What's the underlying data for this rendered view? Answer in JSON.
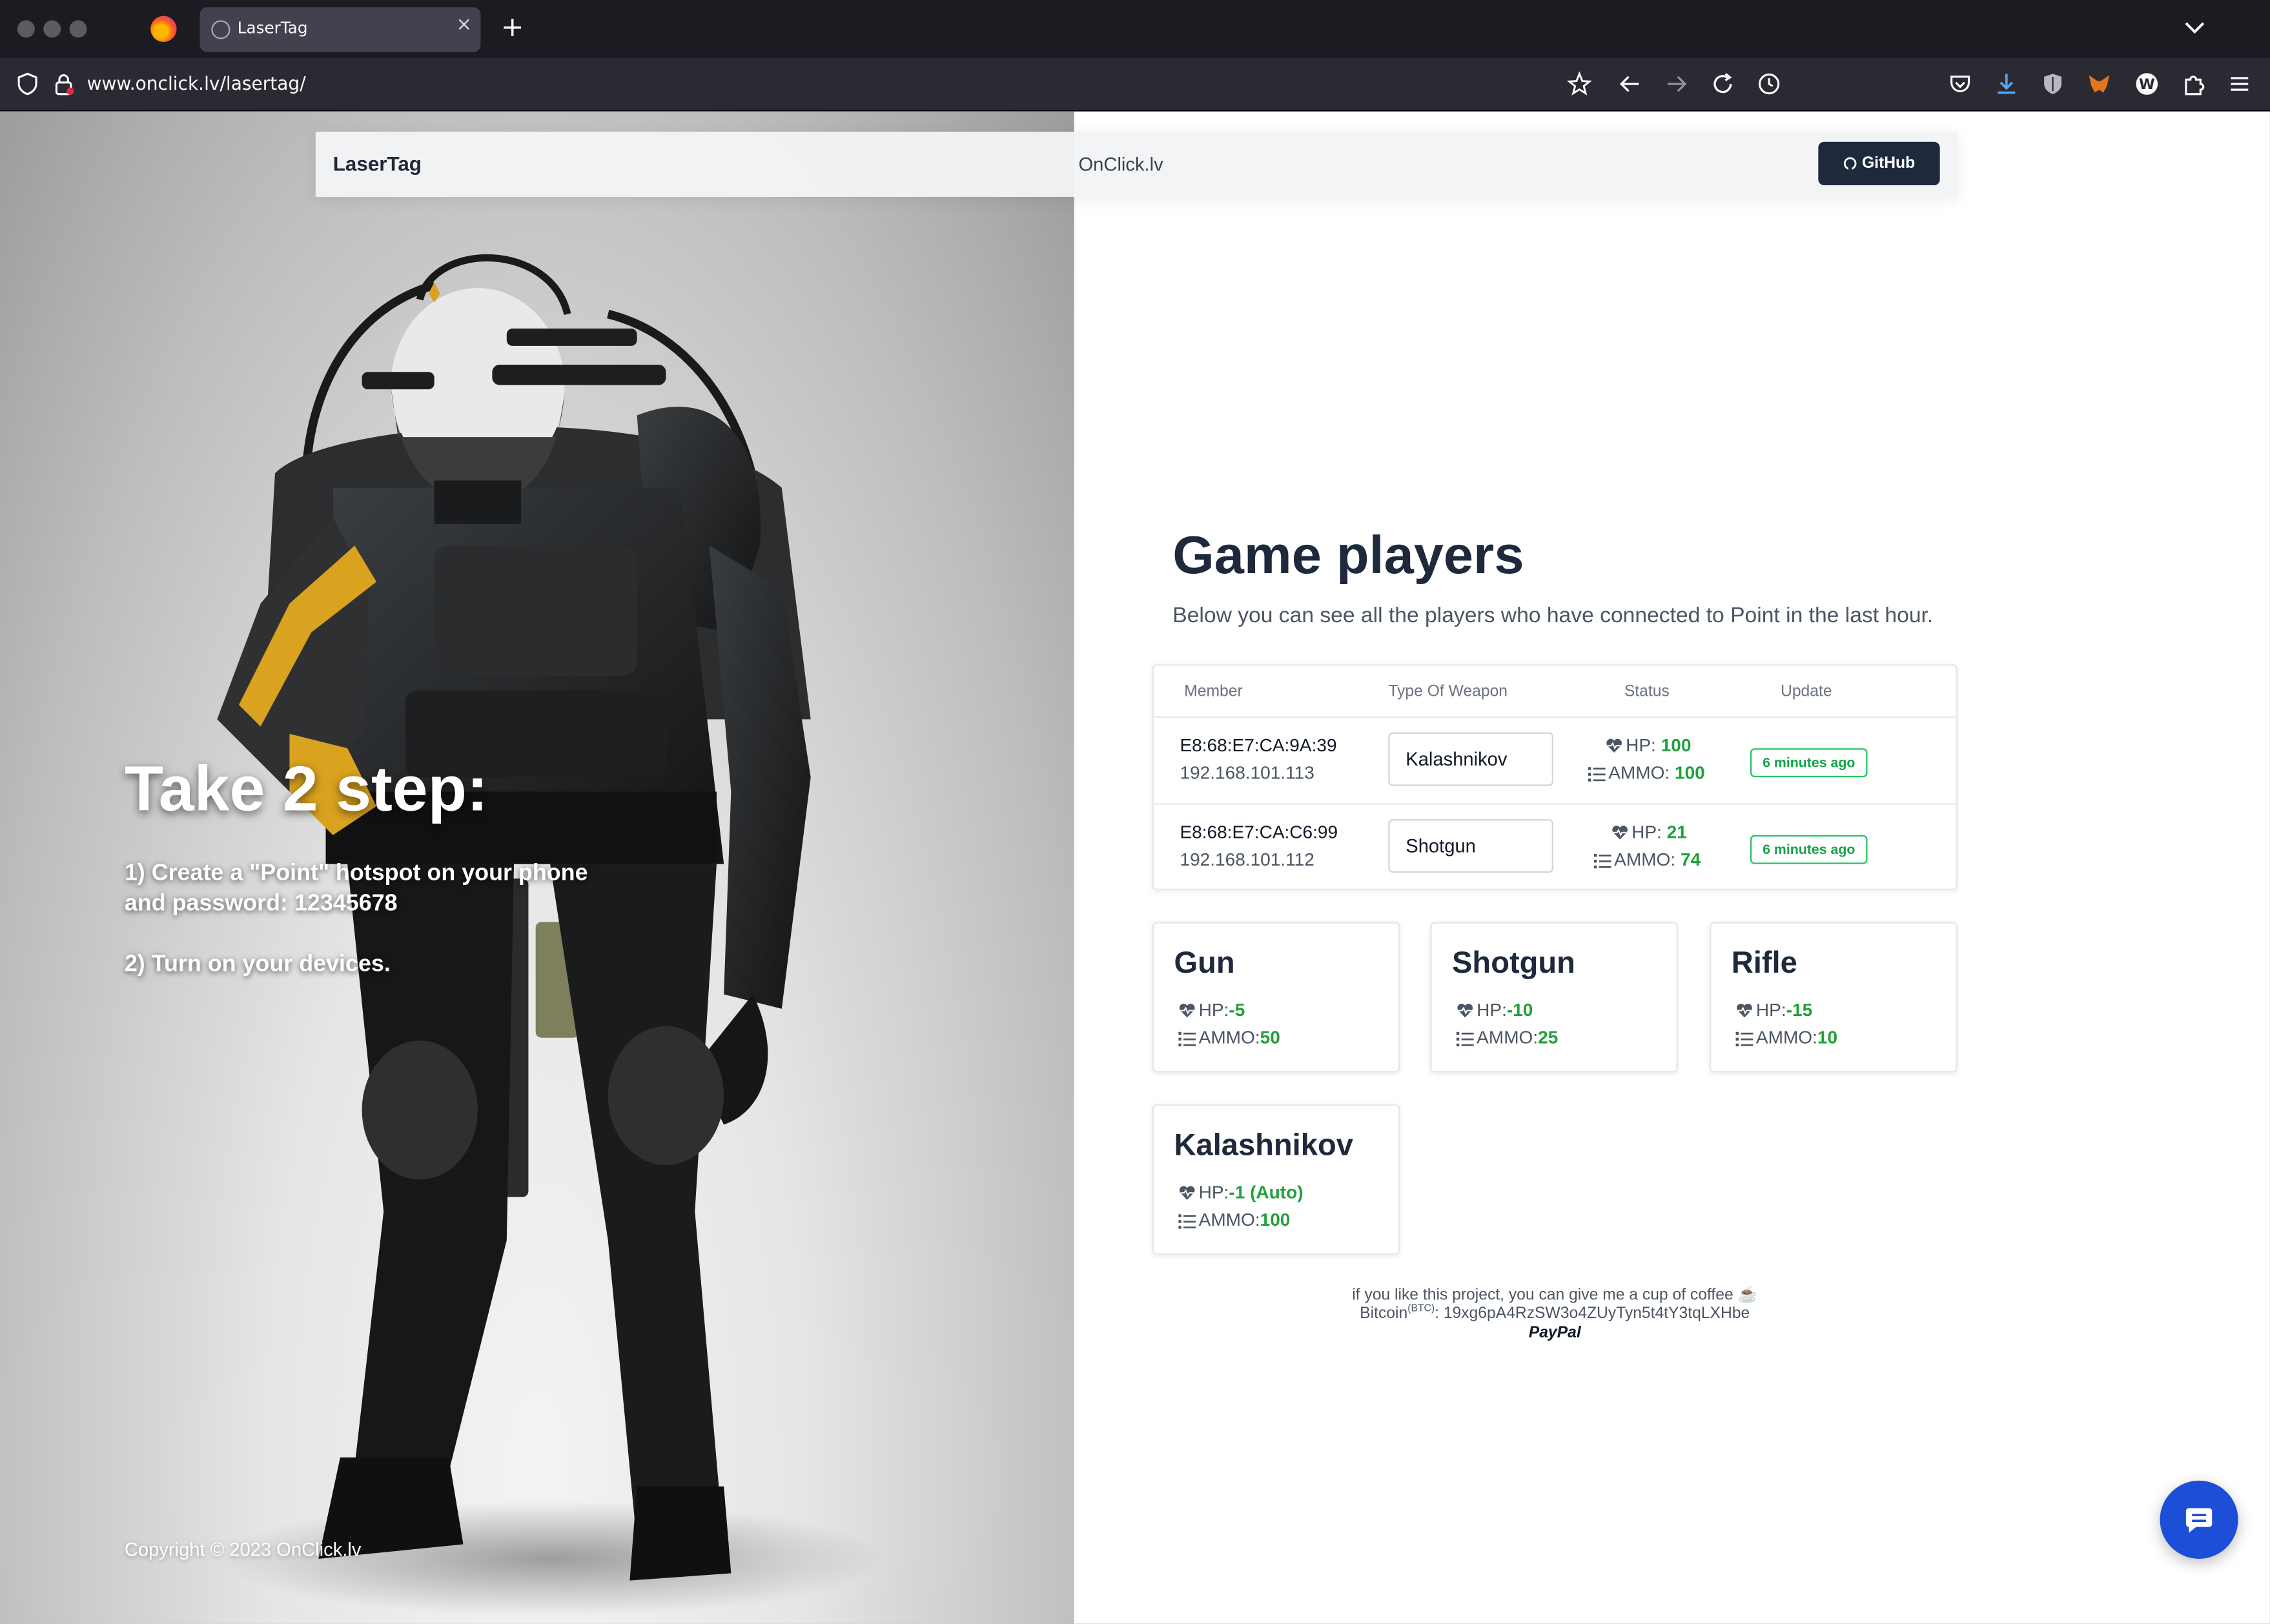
{
  "browser": {
    "tab_title": "LaserTag",
    "tab_close": "×",
    "new_tab": "+",
    "url": "www.onclick.lv/lasertag/"
  },
  "nav": {
    "brand": "LaserTag",
    "link": "OnClick.lv",
    "github_label": "GitHub"
  },
  "hero": {
    "title": "Take 2 step:",
    "step1_line1": "1) Create a \"Point\" hotspot on your phone",
    "step1_line2": "and password: 12345678",
    "step2": "2) Turn on your devices.",
    "copyright": "Copyright © 2023 OnClick.lv"
  },
  "players": {
    "title": "Game players",
    "subtitle": "Below you can see all the players who have connected to Point in the last hour.",
    "columns": [
      "Member",
      "Type Of Weapon",
      "Status",
      "Update"
    ],
    "rows": [
      {
        "mac": "E8:68:E7:CA:9A:39",
        "ip": "192.168.101.113",
        "weapon": "Kalashnikov",
        "hp_label": "HP:",
        "hp": "100",
        "ammo_label": "AMMO:",
        "ammo": "100",
        "update": "6 minutes ago"
      },
      {
        "mac": "E8:68:E7:CA:C6:99",
        "ip": "192.168.101.112",
        "weapon": "Shotgun",
        "hp_label": "HP:",
        "hp": "21",
        "ammo_label": "AMMO:",
        "ammo": "74",
        "update": "6 minutes ago"
      }
    ]
  },
  "weapons": [
    {
      "name": "Gun",
      "hp_label": "HP:",
      "hp": "-5",
      "ammo_label": "AMMO:",
      "ammo": "50"
    },
    {
      "name": "Shotgun",
      "hp_label": "HP:",
      "hp": "-10",
      "ammo_label": "AMMO:",
      "ammo": "25"
    },
    {
      "name": "Rifle",
      "hp_label": "HP:",
      "hp": "-15",
      "ammo_label": "AMMO:",
      "ammo": "10"
    },
    {
      "name": "Kalashnikov",
      "hp_label": "HP:",
      "hp": "-1 (Auto)",
      "ammo_label": "AMMO:",
      "ammo": "100"
    }
  ],
  "footer": {
    "coffee": "if you like this project, you can give me a cup of coffee ☕",
    "btc_label": "Bitcoin",
    "btc_sup": "(BTC)",
    "btc_address": ": 19xg6pA4RzSW3o4ZUyTyn5t4tY3tqLXHbe",
    "paypal": "PayPal"
  },
  "colors": {
    "accent_green": "#22a03c",
    "dark_button": "#1e293b",
    "chat_blue": "#1d4ed8"
  }
}
